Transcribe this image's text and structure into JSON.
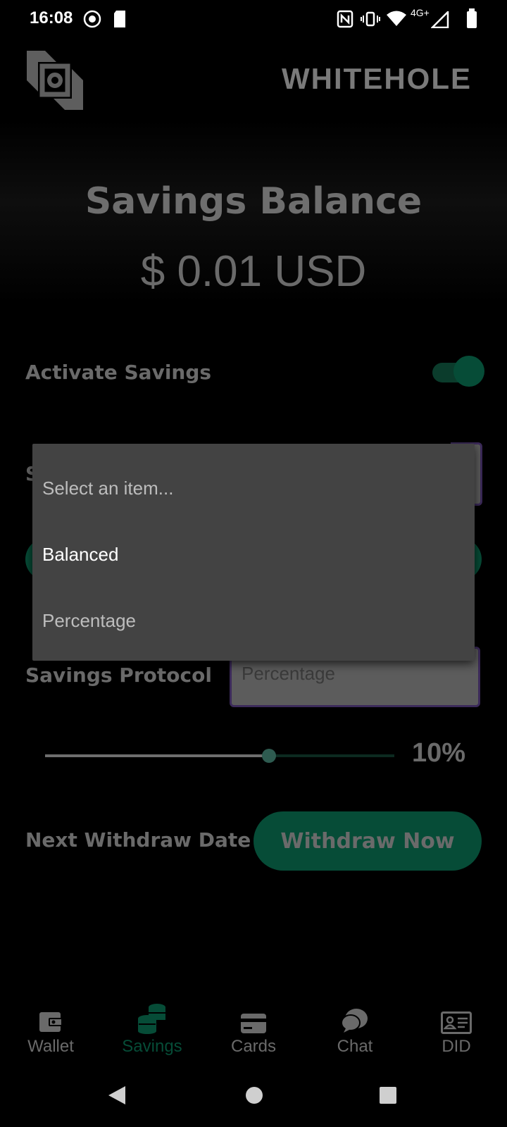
{
  "status_bar": {
    "time": "16:08",
    "network": "4G+"
  },
  "header": {
    "brand": "WHITEHOLE"
  },
  "balance": {
    "title": "Savings Balance",
    "amount": "$ 0.01 USD"
  },
  "activate_savings": {
    "label": "Activate Savings",
    "enabled": true
  },
  "covered_label": {
    "visible_initial": "S"
  },
  "savings_protocol": {
    "label": "Savings Protocol",
    "value": "Percentage"
  },
  "slider": {
    "value_label": "10%",
    "level_fraction": 0.64
  },
  "withdraw": {
    "label": "Next Withdraw Date",
    "button": "Withdraw Now"
  },
  "dropdown": {
    "placeholder": "Select an item...",
    "options": [
      "Balanced",
      "Percentage"
    ],
    "highlighted": "Balanced"
  },
  "bottom_nav": {
    "items": [
      {
        "label": "Wallet",
        "icon": "wallet-icon"
      },
      {
        "label": "Savings",
        "icon": "coins-icon",
        "active": true
      },
      {
        "label": "Cards",
        "icon": "card-icon"
      },
      {
        "label": "Chat",
        "icon": "chat-icon"
      },
      {
        "label": "DID",
        "icon": "id-card-icon"
      }
    ]
  },
  "colors": {
    "accent": "#064c37",
    "popup_bg": "#434343",
    "muted_text": "#6a6a6a"
  }
}
